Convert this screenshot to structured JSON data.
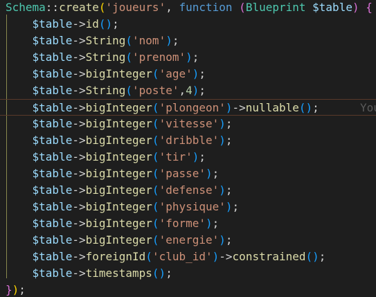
{
  "editor": {
    "lines": [
      [
        {
          "t": "Schema",
          "c": "class"
        },
        {
          "t": "::",
          "c": "punct"
        },
        {
          "t": "create",
          "c": "func"
        },
        {
          "t": "(",
          "c": "b1"
        },
        {
          "t": "'joueurs'",
          "c": "str"
        },
        {
          "t": ", ",
          "c": "punct"
        },
        {
          "t": "function",
          "c": "kw"
        },
        {
          "t": " ",
          "c": "punct"
        },
        {
          "t": "(",
          "c": "b2"
        },
        {
          "t": "Blueprint",
          "c": "class"
        },
        {
          "t": " ",
          "c": "punct"
        },
        {
          "t": "$table",
          "c": "var"
        },
        {
          "t": ")",
          "c": "b2"
        },
        {
          "t": " ",
          "c": "punct"
        },
        {
          "t": "{",
          "c": "b2"
        }
      ],
      [
        {
          "t": "    ",
          "c": "punct"
        },
        {
          "t": "$table",
          "c": "var"
        },
        {
          "t": "->",
          "c": "punct"
        },
        {
          "t": "id",
          "c": "func"
        },
        {
          "t": "()",
          "c": "b3"
        },
        {
          "t": ";",
          "c": "punct"
        }
      ],
      [
        {
          "t": "    ",
          "c": "punct"
        },
        {
          "t": "$table",
          "c": "var"
        },
        {
          "t": "->",
          "c": "punct"
        },
        {
          "t": "String",
          "c": "func"
        },
        {
          "t": "(",
          "c": "b3"
        },
        {
          "t": "'nom'",
          "c": "str"
        },
        {
          "t": ")",
          "c": "b3"
        },
        {
          "t": ";",
          "c": "punct"
        }
      ],
      [
        {
          "t": "    ",
          "c": "punct"
        },
        {
          "t": "$table",
          "c": "var"
        },
        {
          "t": "->",
          "c": "punct"
        },
        {
          "t": "String",
          "c": "func"
        },
        {
          "t": "(",
          "c": "b3"
        },
        {
          "t": "'prenom'",
          "c": "str"
        },
        {
          "t": ")",
          "c": "b3"
        },
        {
          "t": ";",
          "c": "punct"
        }
      ],
      [
        {
          "t": "    ",
          "c": "punct"
        },
        {
          "t": "$table",
          "c": "var"
        },
        {
          "t": "->",
          "c": "punct"
        },
        {
          "t": "bigInteger",
          "c": "func"
        },
        {
          "t": "(",
          "c": "b3"
        },
        {
          "t": "'age'",
          "c": "str"
        },
        {
          "t": ")",
          "c": "b3"
        },
        {
          "t": ";",
          "c": "punct"
        }
      ],
      [
        {
          "t": "    ",
          "c": "punct"
        },
        {
          "t": "$table",
          "c": "var"
        },
        {
          "t": "->",
          "c": "punct"
        },
        {
          "t": "String",
          "c": "func"
        },
        {
          "t": "(",
          "c": "b3"
        },
        {
          "t": "'poste'",
          "c": "str"
        },
        {
          "t": ",",
          "c": "punct"
        },
        {
          "t": "4",
          "c": "num"
        },
        {
          "t": ")",
          "c": "b3"
        },
        {
          "t": ";",
          "c": "punct"
        }
      ],
      [
        {
          "t": "    ",
          "c": "punct"
        },
        {
          "t": "$table",
          "c": "var"
        },
        {
          "t": "->",
          "c": "punct"
        },
        {
          "t": "bigInteger",
          "c": "func"
        },
        {
          "t": "(",
          "c": "b3"
        },
        {
          "t": "'plongeon'",
          "c": "str"
        },
        {
          "t": ")",
          "c": "b3"
        },
        {
          "t": "->",
          "c": "punct"
        },
        {
          "t": "nullable",
          "c": "func"
        },
        {
          "t": "()",
          "c": "b3"
        },
        {
          "t": ";",
          "c": "punct"
        }
      ],
      [
        {
          "t": "    ",
          "c": "punct"
        },
        {
          "t": "$table",
          "c": "var"
        },
        {
          "t": "->",
          "c": "punct"
        },
        {
          "t": "bigInteger",
          "c": "func"
        },
        {
          "t": "(",
          "c": "b3"
        },
        {
          "t": "'vitesse'",
          "c": "str"
        },
        {
          "t": ")",
          "c": "b3"
        },
        {
          "t": ";",
          "c": "punct"
        }
      ],
      [
        {
          "t": "    ",
          "c": "punct"
        },
        {
          "t": "$table",
          "c": "var"
        },
        {
          "t": "->",
          "c": "punct"
        },
        {
          "t": "bigInteger",
          "c": "func"
        },
        {
          "t": "(",
          "c": "b3"
        },
        {
          "t": "'dribble'",
          "c": "str"
        },
        {
          "t": ")",
          "c": "b3"
        },
        {
          "t": ";",
          "c": "punct"
        }
      ],
      [
        {
          "t": "    ",
          "c": "punct"
        },
        {
          "t": "$table",
          "c": "var"
        },
        {
          "t": "->",
          "c": "punct"
        },
        {
          "t": "bigInteger",
          "c": "func"
        },
        {
          "t": "(",
          "c": "b3"
        },
        {
          "t": "'tir'",
          "c": "str"
        },
        {
          "t": ")",
          "c": "b3"
        },
        {
          "t": ";",
          "c": "punct"
        }
      ],
      [
        {
          "t": "    ",
          "c": "punct"
        },
        {
          "t": "$table",
          "c": "var"
        },
        {
          "t": "->",
          "c": "punct"
        },
        {
          "t": "bigInteger",
          "c": "func"
        },
        {
          "t": "(",
          "c": "b3"
        },
        {
          "t": "'passe'",
          "c": "str"
        },
        {
          "t": ")",
          "c": "b3"
        },
        {
          "t": ";",
          "c": "punct"
        }
      ],
      [
        {
          "t": "    ",
          "c": "punct"
        },
        {
          "t": "$table",
          "c": "var"
        },
        {
          "t": "->",
          "c": "punct"
        },
        {
          "t": "bigInteger",
          "c": "func"
        },
        {
          "t": "(",
          "c": "b3"
        },
        {
          "t": "'defense'",
          "c": "str"
        },
        {
          "t": ")",
          "c": "b3"
        },
        {
          "t": ";",
          "c": "punct"
        }
      ],
      [
        {
          "t": "    ",
          "c": "punct"
        },
        {
          "t": "$table",
          "c": "var"
        },
        {
          "t": "->",
          "c": "punct"
        },
        {
          "t": "bigInteger",
          "c": "func"
        },
        {
          "t": "(",
          "c": "b3"
        },
        {
          "t": "'physique'",
          "c": "str"
        },
        {
          "t": ")",
          "c": "b3"
        },
        {
          "t": ";",
          "c": "punct"
        }
      ],
      [
        {
          "t": "    ",
          "c": "punct"
        },
        {
          "t": "$table",
          "c": "var"
        },
        {
          "t": "->",
          "c": "punct"
        },
        {
          "t": "bigInteger",
          "c": "func"
        },
        {
          "t": "(",
          "c": "b3"
        },
        {
          "t": "'forme'",
          "c": "str"
        },
        {
          "t": ")",
          "c": "b3"
        },
        {
          "t": ";",
          "c": "punct"
        }
      ],
      [
        {
          "t": "    ",
          "c": "punct"
        },
        {
          "t": "$table",
          "c": "var"
        },
        {
          "t": "->",
          "c": "punct"
        },
        {
          "t": "bigInteger",
          "c": "func"
        },
        {
          "t": "(",
          "c": "b3"
        },
        {
          "t": "'energie'",
          "c": "str"
        },
        {
          "t": ")",
          "c": "b3"
        },
        {
          "t": ";",
          "c": "punct"
        }
      ],
      [
        {
          "t": "    ",
          "c": "punct"
        },
        {
          "t": "$table",
          "c": "var"
        },
        {
          "t": "->",
          "c": "punct"
        },
        {
          "t": "foreignId",
          "c": "func"
        },
        {
          "t": "(",
          "c": "b3"
        },
        {
          "t": "'club_id'",
          "c": "str"
        },
        {
          "t": ")",
          "c": "b3"
        },
        {
          "t": "->",
          "c": "punct"
        },
        {
          "t": "constrained",
          "c": "func"
        },
        {
          "t": "()",
          "c": "b3"
        },
        {
          "t": ";",
          "c": "punct"
        }
      ],
      [
        {
          "t": "    ",
          "c": "punct"
        },
        {
          "t": "$table",
          "c": "var"
        },
        {
          "t": "->",
          "c": "punct"
        },
        {
          "t": "timestamps",
          "c": "func"
        },
        {
          "t": "()",
          "c": "b3"
        },
        {
          "t": ";",
          "c": "punct"
        }
      ],
      [
        {
          "t": "}",
          "c": "b2"
        },
        {
          "t": ")",
          "c": "b1"
        },
        {
          "t": ";",
          "c": "punct"
        }
      ]
    ],
    "current_line_index": 6,
    "inline_hint": "You"
  }
}
